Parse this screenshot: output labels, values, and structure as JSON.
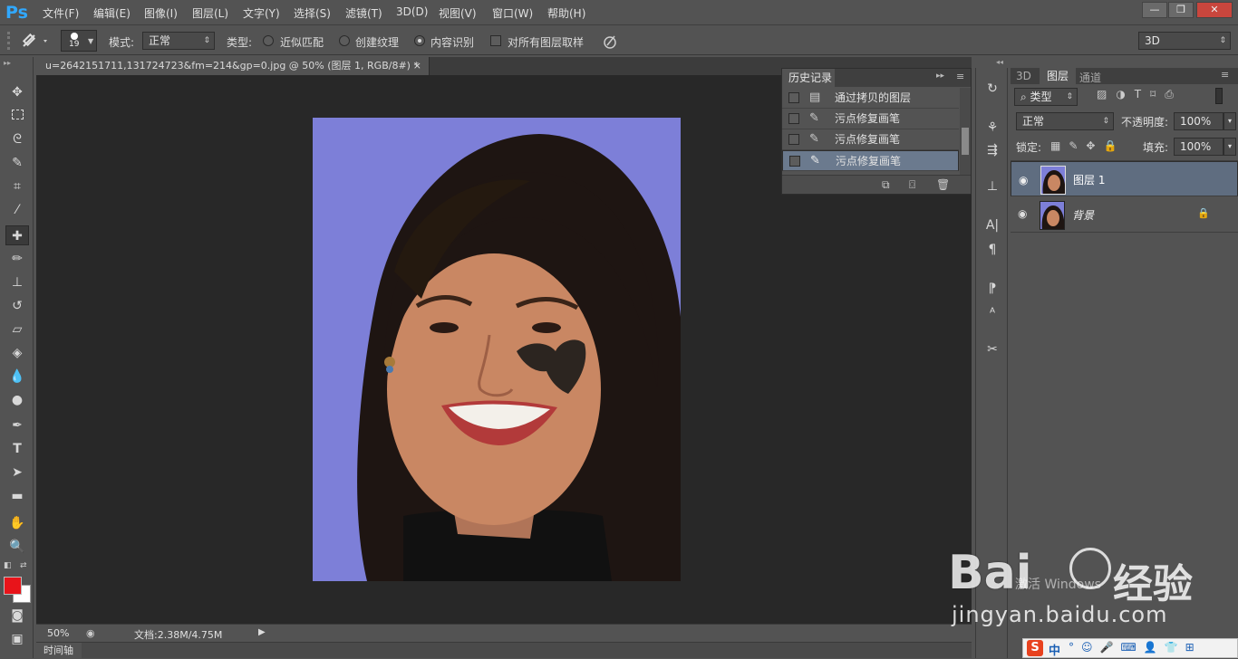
{
  "app": {
    "logo": "Ps",
    "accent": "#31a8ff"
  },
  "menu": [
    "文件(F)",
    "编辑(E)",
    "图像(I)",
    "图层(L)",
    "文字(Y)",
    "选择(S)",
    "滤镜(T)",
    "3D(D)",
    "视图(V)",
    "窗口(W)",
    "帮助(H)"
  ],
  "window_controls": {
    "minimize": "—",
    "restore": "❐",
    "close": "✕"
  },
  "options": {
    "brush_size": "19",
    "mode_label": "模式:",
    "mode_value": "正常",
    "type_label": "类型:",
    "type_options": [
      "近似匹配",
      "创建纹理",
      "内容识别"
    ],
    "type_selected": "内容识别",
    "sample_all_label": "对所有图层取样",
    "workspace": "3D"
  },
  "document": {
    "tab_title": "u=2642151711,131724723&fm=214&gp=0.jpg @ 50% (图层 1, RGB/8#) *",
    "tab_close": "×",
    "zoom": "50%",
    "doc_info": "文档:2.38M/4.75M",
    "timeline_label": "时间轴"
  },
  "history": {
    "title": "历史记录",
    "items": [
      "通过拷贝的图层",
      "污点修复画笔",
      "污点修复画笔",
      "污点修复画笔"
    ],
    "selected_index": 3
  },
  "layers_panel": {
    "tabs": [
      "3D",
      "图层",
      "通道"
    ],
    "active_tab": "图层",
    "filter_label": "类型",
    "blend_mode": "正常",
    "opacity_label": "不透明度:",
    "opacity_value": "100%",
    "lock_label": "锁定:",
    "fill_label": "填充:",
    "fill_value": "100%",
    "layers": [
      {
        "name": "图层 1",
        "selected": true
      },
      {
        "name": "背景",
        "locked": true
      }
    ]
  },
  "colors": {
    "foreground": "#e8141a",
    "background": "#ffffff"
  },
  "watermark": {
    "brand": "Bai",
    "brand2": "经验",
    "url": "jingyan.baidu.com",
    "activate": "激活 Windows"
  },
  "taskbar": {
    "ime": "中"
  }
}
